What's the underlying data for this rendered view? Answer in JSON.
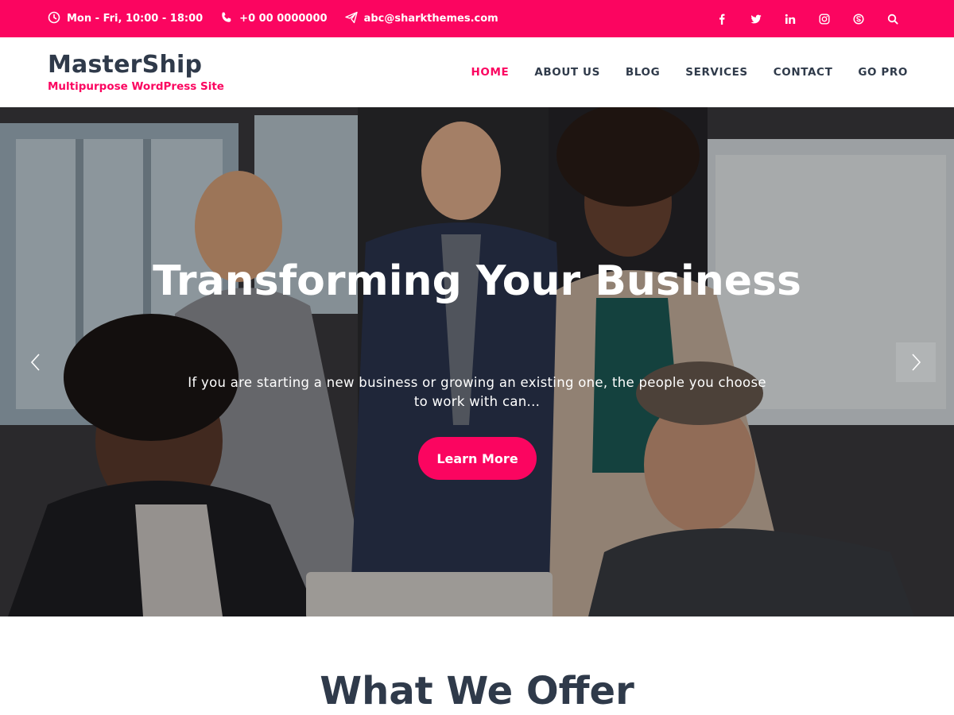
{
  "topbar": {
    "hours": "Mon - Fri, 10:00 - 18:00",
    "phone": "+0 00 0000000",
    "email": "abc@sharkthemes.com",
    "social": [
      "facebook-icon",
      "twitter-icon",
      "linkedin-icon",
      "instagram-icon",
      "skype-icon",
      "search-icon"
    ]
  },
  "header": {
    "site_title": "MasterShip",
    "tagline": "Multipurpose WordPress Site",
    "nav": [
      {
        "label": "HOME",
        "active": true
      },
      {
        "label": "ABOUT US",
        "active": false
      },
      {
        "label": "BLOG",
        "active": false
      },
      {
        "label": "SERVICES",
        "active": false
      },
      {
        "label": "CONTACT",
        "active": false
      },
      {
        "label": "GO PRO",
        "active": false
      }
    ]
  },
  "hero": {
    "title": "Transforming Your Business",
    "description": "If you are starting a new business or growing an existing one, the people you choose to work with can...",
    "button_label": "Learn More"
  },
  "section": {
    "title": "What We Offer"
  },
  "colors": {
    "accent": "#fb0560",
    "text_dark": "#2f3a4a",
    "white": "#ffffff"
  }
}
